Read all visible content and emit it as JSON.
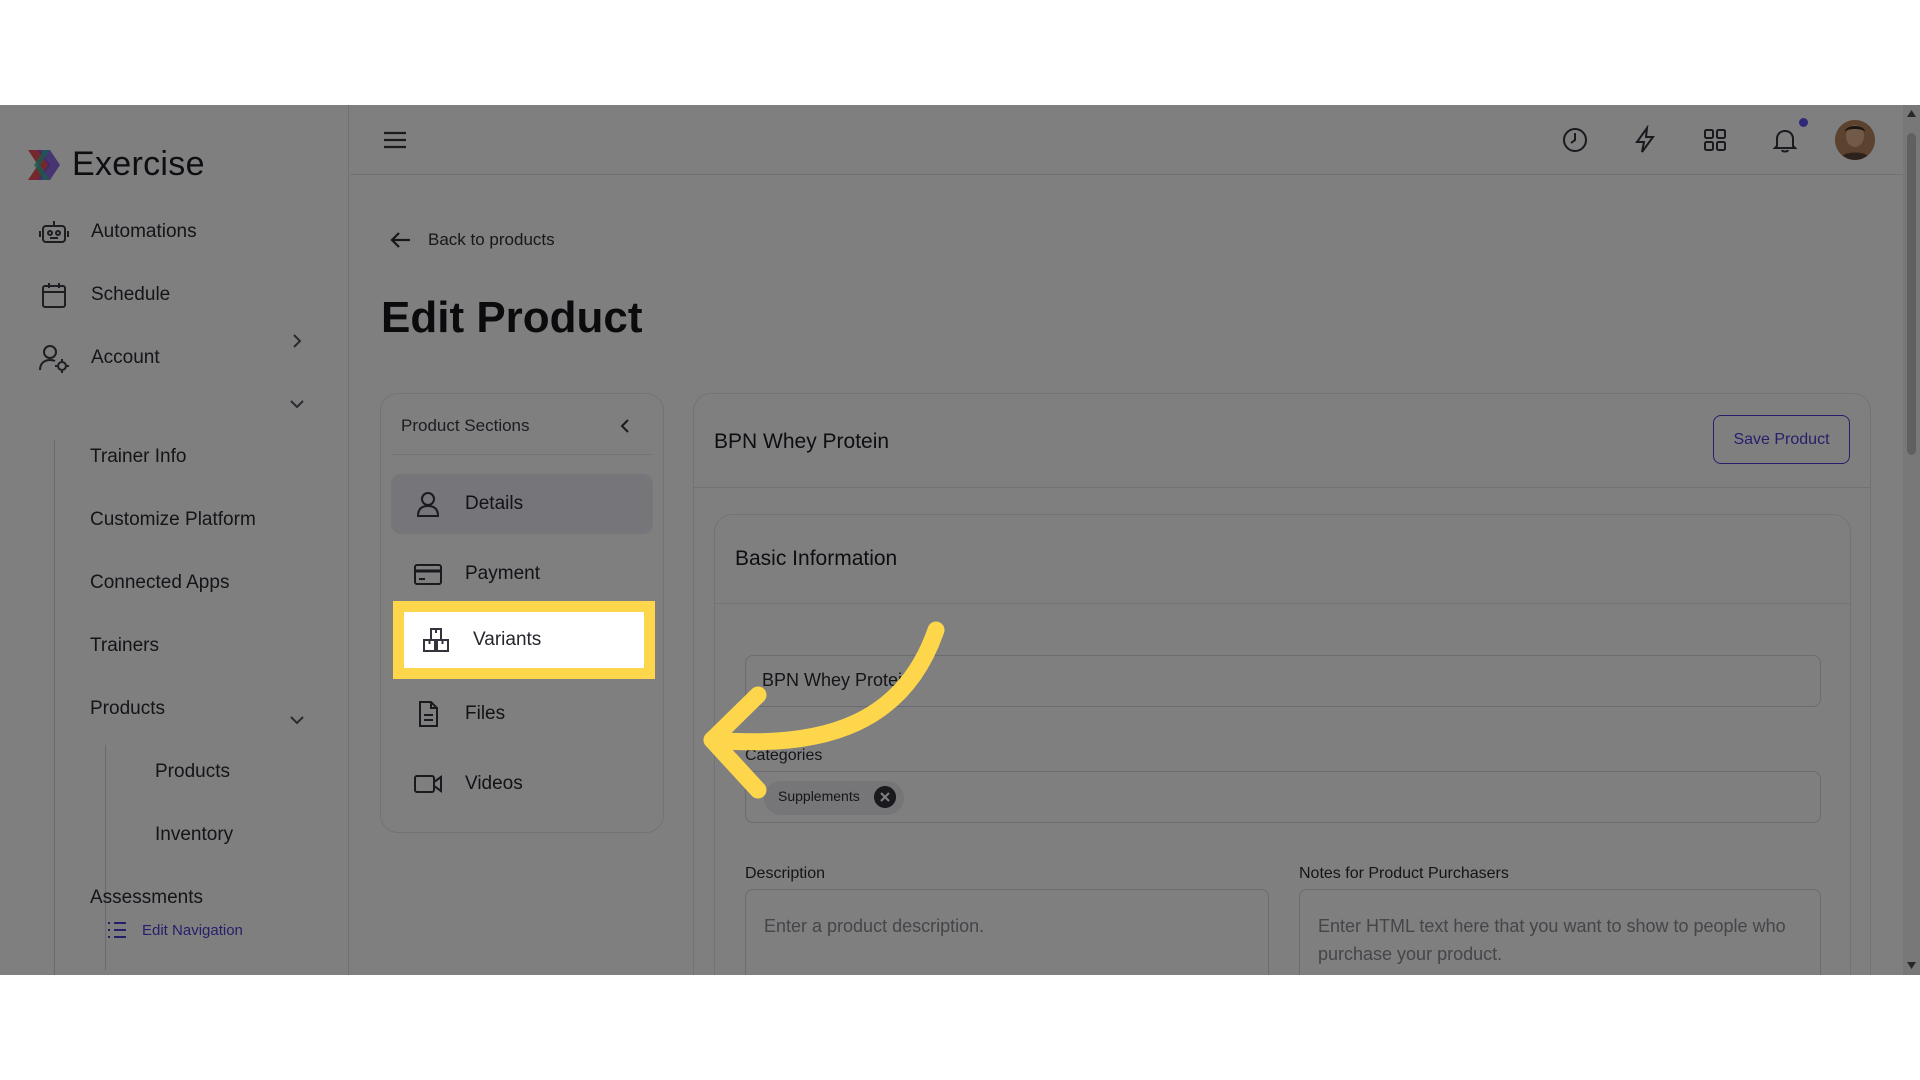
{
  "app": {
    "name": "Exercise",
    "colors": {
      "accent": "#4b3fd6",
      "highlight": "#fdd64b",
      "notification": "#5b52f0"
    }
  },
  "sidebar": {
    "items": [
      {
        "label": "Automations",
        "icon": "robot-icon"
      },
      {
        "label": "Schedule",
        "icon": "calendar-icon",
        "expandable": true
      },
      {
        "label": "Account",
        "icon": "user-gear-icon",
        "expanded": true
      }
    ],
    "account_children": [
      "Trainer Info",
      "Customize Platform",
      "Connected Apps",
      "Trainers",
      "Products"
    ],
    "products_children": [
      "Products",
      "Inventory"
    ],
    "after": "Assessments",
    "edit_nav": "Edit Navigation"
  },
  "topbar": {
    "icons": [
      "menu-icon",
      "clock-icon",
      "lightning-icon",
      "grid-icon",
      "bell-icon"
    ]
  },
  "main": {
    "back_label": "Back to products",
    "page_title": "Edit Product",
    "sections": {
      "title": "Product Sections",
      "items": [
        "Details",
        "Payment",
        "Variants",
        "Files",
        "Videos"
      ],
      "active": "Details",
      "highlighted": "Variants"
    },
    "card": {
      "title": "BPN Whey Protein",
      "save_label": "Save Product",
      "basic_info_title": "Basic Information",
      "name_value": "BPN Whey Protein",
      "categories_label": "Categories",
      "category_chip": "Supplements",
      "description_label": "Description",
      "description_placeholder": "Enter a product description.",
      "notes_label": "Notes for Product Purchasers",
      "notes_placeholder": "Enter HTML text here that you want to show to people who purchase your product."
    }
  }
}
